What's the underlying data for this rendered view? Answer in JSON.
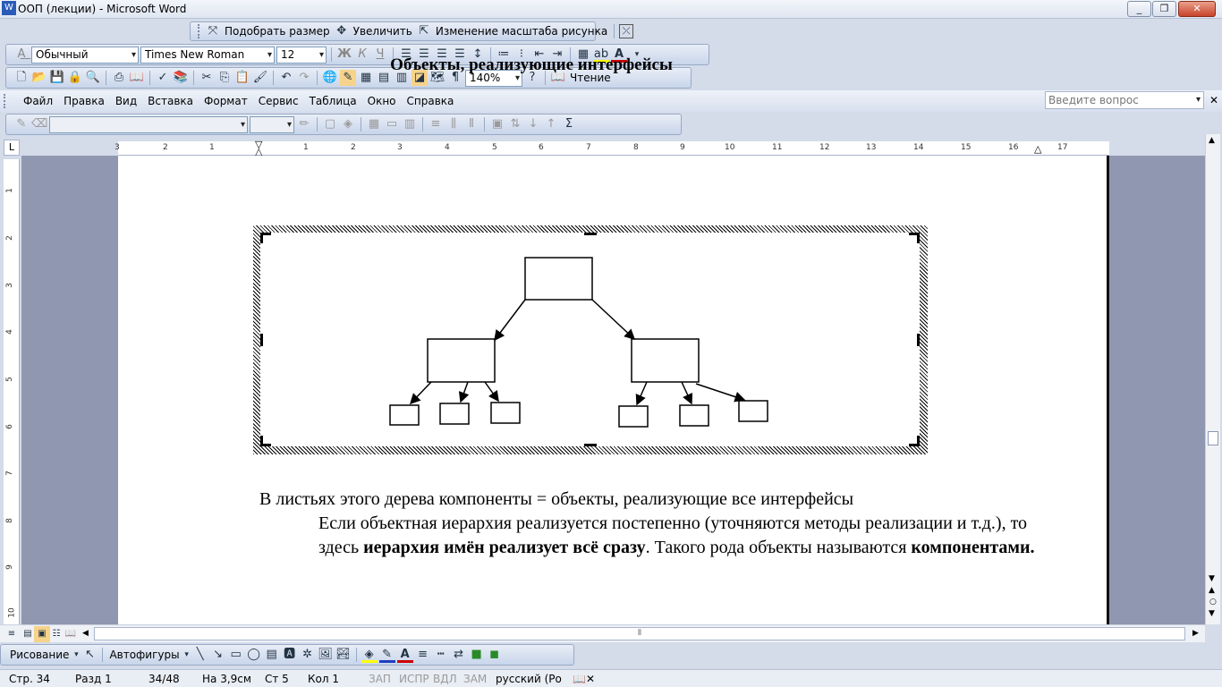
{
  "window": {
    "title": "ООП (лекции) - Microsoft Word",
    "minimize": "_",
    "restore": "❐",
    "close": "✕"
  },
  "picture_toolbar": {
    "fit_label": "Подобрать размер",
    "zoom_in_label": "Увеличить",
    "scale_label": "Изменение масштаба рисунка"
  },
  "format_toolbar": {
    "style": "Обычный",
    "font": "Times New Roman",
    "size": "12",
    "bold": "Ж",
    "italic": "К",
    "underline": "Ч",
    "font_color_letter": "A"
  },
  "standard_toolbar": {
    "zoom": "140%",
    "read_label": "Чтение",
    "pilcrow": "¶"
  },
  "menu": {
    "items": [
      "Файл",
      "Правка",
      "Вид",
      "Вставка",
      "Формат",
      "Сервис",
      "Таблица",
      "Окно",
      "Справка"
    ],
    "question_placeholder": "Введите вопрос",
    "close": "✕"
  },
  "ruler": {
    "corner": "L",
    "numbers": [
      "3",
      "2",
      "1",
      "1",
      "2",
      "3",
      "4",
      "5",
      "6",
      "7",
      "8",
      "9",
      "10",
      "11",
      "12",
      "13",
      "14",
      "15",
      "16",
      "17"
    ],
    "vertical_numbers": [
      "1",
      "2",
      "3",
      "4",
      "5",
      "6",
      "7",
      "8",
      "9",
      "10"
    ]
  },
  "document": {
    "heading": "Объекты, реализующие интерфейсы",
    "para_line1": "В листьях этого дерева компоненты = объекты, реализующие все интерфейсы",
    "para2_start": "Если объектная иерархия  реализуется постепенно (уточняются методы реализации и т.д.), то здесь ",
    "para2_bold": "иерархия имён реализует всё сразу",
    "para2_mid": ". Такого рода объекты называются ",
    "para2_bold2": "компонентами."
  },
  "drawing_toolbar": {
    "drawing_label": "Рисование",
    "autoshapes_label": "Автофигуры"
  },
  "status_bar": {
    "page": "Стр. 34",
    "section": "Разд 1",
    "pages": "34/48",
    "at": "На 3,9см",
    "line": "Ст 5",
    "col": "Кол 1",
    "rec": "ЗАП",
    "trk": "ИСПР",
    "ext": "ВДЛ",
    "ovr": "ЗАМ",
    "lang": "русский (Ро"
  },
  "colors": {
    "toolbar_bg": "#c8d5ea",
    "workspace": "#9097b0",
    "font_color_red": "#cc0000",
    "highlight_yellow": "#ffff00"
  }
}
